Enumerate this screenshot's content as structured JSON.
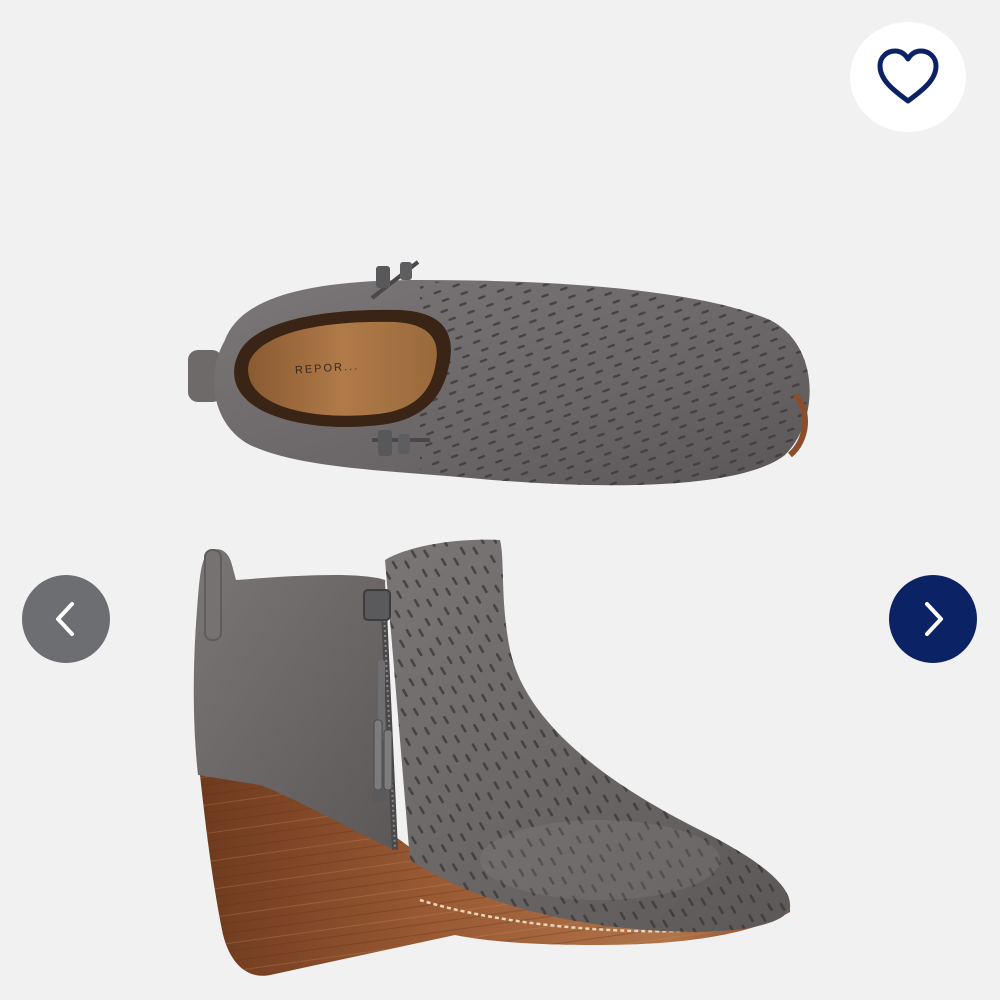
{
  "image": {
    "alt": "",
    "insole_brand": "REPOR..."
  },
  "controls": {
    "favorite_icon": "heart-outline-icon",
    "prev_icon": "chevron-left-icon",
    "next_icon": "chevron-right-icon"
  },
  "colors": {
    "background": "#f1f1f2",
    "favorite_button_bg": "#ffffff",
    "heart_stroke": "#0b2265",
    "prev_button_bg": "#6d6e72",
    "next_button_bg": "#0b2265",
    "boot_suede": "#6f6c6d",
    "wedge_wood": "#8a4e2c"
  }
}
